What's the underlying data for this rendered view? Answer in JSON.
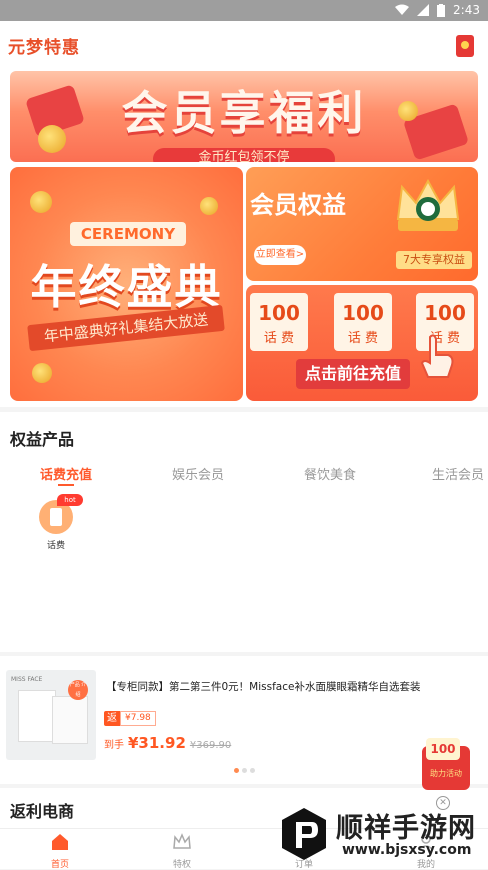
{
  "statusbar": {
    "time": "2:43"
  },
  "header": {
    "app_title": "元梦特惠"
  },
  "banners": {
    "top_title": "会员享福利",
    "top_pill": "金币红包领不停",
    "left_tag": "CEREMONY",
    "left_title": "年终盛典",
    "left_ribbon": "年中盛典好礼集结大放送",
    "right_top_title": "会员权益",
    "right_top_view": "立即查看>",
    "right_top_badge": "7大专享权益",
    "phone_cards": [
      {
        "num": "100",
        "label": "话 费"
      },
      {
        "num": "100",
        "label": "话 费"
      },
      {
        "num": "100",
        "label": "话 费"
      }
    ],
    "right_bottom_cta": "点击前往充值"
  },
  "section_products": {
    "title": "权益产品",
    "tabs": [
      "话费充值",
      "娱乐会员",
      "餐饮美食",
      "生活会员"
    ],
    "active_tab": 0,
    "items": [
      {
        "label": "话费",
        "tag": "hot"
      }
    ]
  },
  "goods": {
    "brand": "MISS FACE",
    "stamp": "产品 介绍",
    "title": "【专柜同款】第二第三件0元！Missface补水面膜眼霜精华自选套装",
    "rebate_tag": "返",
    "rebate_amount": "¥7.98",
    "price_label": "到手",
    "price": "¥31.92",
    "old_price": "¥369.90",
    "dots": 3,
    "active_dot": 0
  },
  "float_promo": {
    "num": "100",
    "text": "助力活动"
  },
  "section_ecommerce": {
    "title": "返利电商"
  },
  "bottom_nav": [
    {
      "label": "首页",
      "icon": "home-icon",
      "active": true
    },
    {
      "label": "特权",
      "icon": "crown-icon",
      "active": false
    },
    {
      "label": "订单",
      "icon": "order-icon",
      "active": false
    },
    {
      "label": "我的",
      "icon": "user-icon",
      "active": false
    }
  ],
  "watermark": {
    "title": "顺祥手游网",
    "url": "www.bjsxsy.com"
  },
  "colors": {
    "accent": "#ff5a2c",
    "brand": "#e8502a"
  }
}
